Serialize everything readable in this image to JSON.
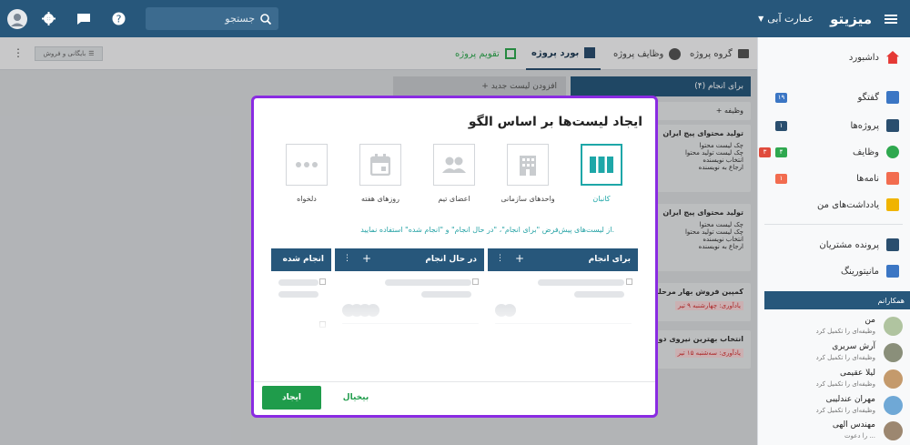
{
  "app": {
    "logo": "میزیتو",
    "workspace": "عمارت آبی"
  },
  "search": {
    "placeholder": "جستجو"
  },
  "sidebar": {
    "items": [
      {
        "label": "داشبورد",
        "color": "#e53935"
      },
      {
        "label": "گفتگو",
        "color": "#3b76c4"
      },
      {
        "label": "پروژه‌ها",
        "color": "#2a4e6e"
      },
      {
        "label": "وظایف",
        "color": "#2fa84f"
      },
      {
        "label": "نامه‌ها",
        "color": "#f26c4f"
      },
      {
        "label": "یادداشت‌های من",
        "color": "#f0b400"
      },
      {
        "label": "پرونده مشتریان",
        "color": "#2a4e6e"
      },
      {
        "label": "مانیتورینگ",
        "color": "#3b76c4"
      }
    ],
    "badges": {
      "chat": "۱۹",
      "projects": "۱",
      "tasks_green": "۴",
      "tasks_red": "۳",
      "letters": "۱"
    },
    "section_title": "همکارانم",
    "colleagues": [
      {
        "name": "من",
        "status": "وظیفه‌ای را تکمیل کرد",
        "color": "#b0c4a0"
      },
      {
        "name": "آرش سریری",
        "status": "وظیفه‌ای را تکمیل کرد",
        "color": "#8a8f7a"
      },
      {
        "name": "لیلا عقیمی",
        "status": "وظیفه‌ای را تکمیل کرد",
        "color": "#c49a6c"
      },
      {
        "name": "مهران عندلیبی",
        "status": "وظیفه‌ای را تکمیل کرد",
        "color": "#6fa8d6"
      },
      {
        "name": "مهندس الهی",
        "status": "را دعوت ...",
        "color": "#9c8770"
      }
    ]
  },
  "tabs": [
    {
      "label": "گروه پروژه"
    },
    {
      "label": "وظایف پروژه"
    },
    {
      "label": "بورد پروژه"
    },
    {
      "label": "تقویم پروژه"
    }
  ],
  "archive_button": "بایگانی و فروش",
  "board": {
    "list_title": "برای انجام (۴)",
    "add_list": "+ افزودن لیست جدید",
    "add_task": "+ وظیفه",
    "cards": [
      {
        "title": "تولید محتوای پیج ایران",
        "items": [
          "چک لیست محتوا",
          "چک لیست تولید محتوا",
          "انتخاب نویسنده",
          "ارجاع به نویسنده"
        ]
      },
      {
        "title": "تولید محتوای پیج ایران",
        "items": [
          "چک لیست محتوا",
          "چک لیست تولید محتوا",
          "انتخاب نویسنده",
          "ارجاع به نویسنده"
        ]
      },
      {
        "title": "کمپین فروش بهار مرحله",
        "reminder": "یادآوری: چهارشنبه ۹ تیر"
      },
      {
        "title": "انتخاب بهترین نیروی دو",
        "reminder": "یادآوری: سه‌شنبه ۱۵ تیر"
      }
    ]
  },
  "modal": {
    "title": "ایجاد لیست‌ها بر اساس الگو",
    "templates": [
      {
        "label": "کانبان",
        "icon": "kanban-icon"
      },
      {
        "label": "واحدهای سازمانی",
        "icon": "building-icon"
      },
      {
        "label": "اعضای تیم",
        "icon": "team-icon"
      },
      {
        "label": "روزهای هفته",
        "icon": "calendar-icon"
      },
      {
        "label": "دلخواه",
        "icon": "dots-icon"
      }
    ],
    "hint": "از لیست‌های پیش‌فرض \"برای انجام\"، \"در حال انجام\" و \"انجام شده\" استفاده نمایید.",
    "columns": [
      {
        "title": "برای انجام"
      },
      {
        "title": "در حال انجام"
      },
      {
        "title": "انجام شده"
      }
    ],
    "create": "ایجاد",
    "cancel": "بیخیال"
  }
}
